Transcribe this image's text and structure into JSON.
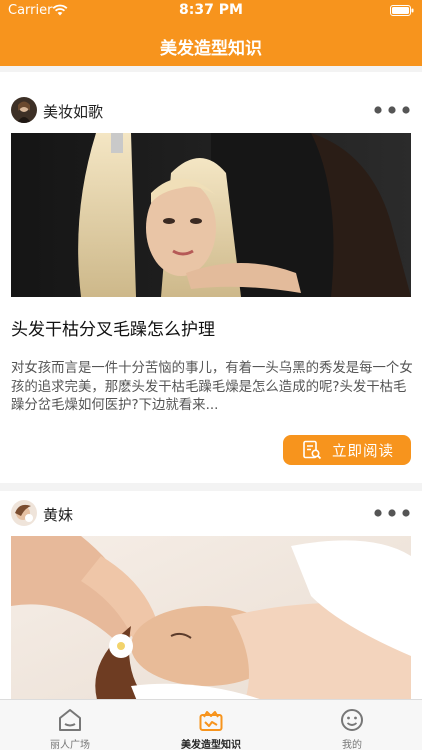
{
  "status_bar": {
    "carrier": "Carrier",
    "time": "8:37 PM"
  },
  "nav": {
    "title": "美发造型知识"
  },
  "posts": [
    {
      "author": "美妆如歌",
      "title": "头发干枯分叉毛躁怎么护理",
      "excerpt": "对女孩而言是一件十分苦恼的事儿，有着一头乌黑的秀发是每一个女孩的追求完美，那麽头发干枯毛躁毛燥是怎么造成的呢?头发干枯毛躁分岔毛燥如何医护?下边就看来...",
      "button_label": "立即阅读"
    },
    {
      "author": "黄妹"
    }
  ],
  "tabs": [
    {
      "label": "丽人广场",
      "icon": "home-icon",
      "active": false
    },
    {
      "label": "美发造型知识",
      "icon": "crown-box-icon",
      "active": true
    },
    {
      "label": "我的",
      "icon": "smiley-icon",
      "active": false
    }
  ],
  "colors": {
    "accent": "#f7941d",
    "tab_inactive": "#777777",
    "background": "#f3f3f3"
  }
}
